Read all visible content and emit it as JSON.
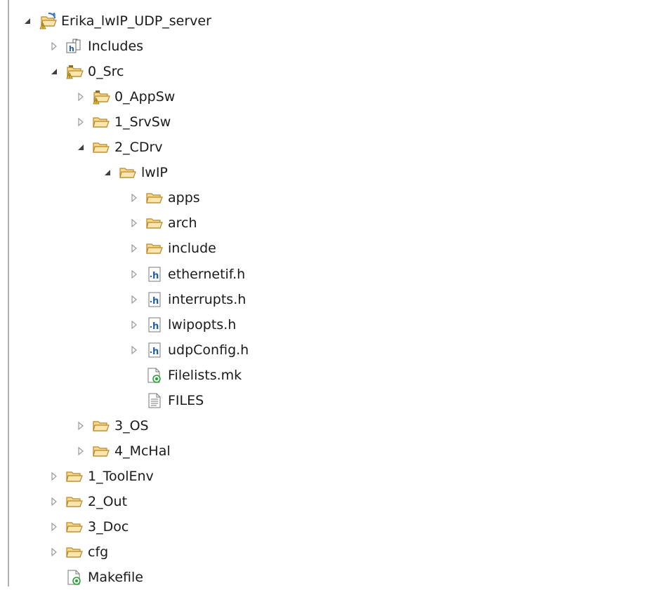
{
  "tree": {
    "items": [
      {
        "label": "Erika_lwIP_UDP_server",
        "depth": 0,
        "expander": "expanded",
        "icon": "project-icon"
      },
      {
        "label": "Includes",
        "depth": 1,
        "expander": "collapsed",
        "icon": "includes-icon"
      },
      {
        "label": "0_Src",
        "depth": 1,
        "expander": "expanded",
        "icon": "source-folder-warning-icon"
      },
      {
        "label": "0_AppSw",
        "depth": 2,
        "expander": "collapsed",
        "icon": "source-folder-warning-icon"
      },
      {
        "label": "1_SrvSw",
        "depth": 2,
        "expander": "collapsed",
        "icon": "folder-icon"
      },
      {
        "label": "2_CDrv",
        "depth": 2,
        "expander": "expanded",
        "icon": "folder-icon"
      },
      {
        "label": "lwIP",
        "depth": 3,
        "expander": "expanded",
        "icon": "folder-icon"
      },
      {
        "label": "apps",
        "depth": 4,
        "expander": "collapsed",
        "icon": "folder-icon"
      },
      {
        "label": "arch",
        "depth": 4,
        "expander": "collapsed",
        "icon": "folder-icon"
      },
      {
        "label": "include",
        "depth": 4,
        "expander": "collapsed",
        "icon": "folder-icon"
      },
      {
        "label": "ethernetif.h",
        "depth": 4,
        "expander": "collapsed",
        "icon": "header-file-icon"
      },
      {
        "label": "interrupts.h",
        "depth": 4,
        "expander": "collapsed",
        "icon": "header-file-icon"
      },
      {
        "label": "lwipopts.h",
        "depth": 4,
        "expander": "collapsed",
        "icon": "header-file-icon"
      },
      {
        "label": "udpConfig.h",
        "depth": 4,
        "expander": "collapsed",
        "icon": "header-file-icon"
      },
      {
        "label": "Filelists.mk",
        "depth": 4,
        "expander": "none",
        "icon": "makefile-icon"
      },
      {
        "label": "FILES",
        "depth": 4,
        "expander": "none",
        "icon": "text-file-icon"
      },
      {
        "label": "3_OS",
        "depth": 2,
        "expander": "collapsed",
        "icon": "folder-icon"
      },
      {
        "label": "4_McHal",
        "depth": 2,
        "expander": "collapsed",
        "icon": "folder-icon"
      },
      {
        "label": "1_ToolEnv",
        "depth": 1,
        "expander": "collapsed",
        "icon": "folder-icon"
      },
      {
        "label": "2_Out",
        "depth": 1,
        "expander": "collapsed",
        "icon": "folder-icon"
      },
      {
        "label": "3_Doc",
        "depth": 1,
        "expander": "collapsed",
        "icon": "folder-icon"
      },
      {
        "label": "cfg",
        "depth": 1,
        "expander": "collapsed",
        "icon": "folder-icon"
      },
      {
        "label": "Makefile",
        "depth": 1,
        "expander": "none",
        "icon": "makefile-icon"
      }
    ]
  },
  "colors": {
    "folder_fill": "#f7d98b",
    "folder_stroke": "#b8862b",
    "twisty_collapsed": "#9a9a9a",
    "twisty_expanded": "#404040",
    "header_blue": "#1f5fa8",
    "make_green": "#2e9a3e"
  }
}
